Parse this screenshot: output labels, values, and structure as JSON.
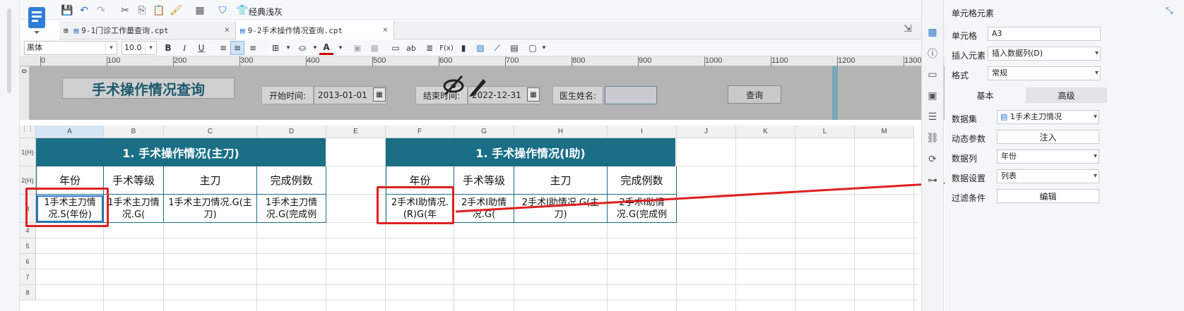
{
  "toolbar": {
    "classic_label": "经典浅灰"
  },
  "tabs": [
    {
      "label": "9-1门诊工作量查询.cpt",
      "close": "×"
    },
    {
      "label": "9-2手术操作情况查询.cpt",
      "close": "×"
    }
  ],
  "format": {
    "font_family": "黑体",
    "font_size": "10.0",
    "bold": "B",
    "italic": "I",
    "underline": "U",
    "text_color": "A",
    "ab": "ab",
    "fx": "F(x)"
  },
  "ruler": {
    "ticks": [
      "0",
      "100",
      "200",
      "300",
      "400",
      "500",
      "600",
      "700",
      "800",
      "900",
      "1000",
      "1100",
      "1200",
      "1300"
    ],
    "vruler_label": "0"
  },
  "parameters": {
    "title": "手术操作情况查询",
    "start_label": "开始时间:",
    "start_value": "2013-01-01",
    "end_label": "结束时间:",
    "end_value": "2022-12-31",
    "doctor_label": "医生姓名:",
    "doctor_value": "",
    "query_button": "查询"
  },
  "grid": {
    "columns": [
      "A",
      "B",
      "C",
      "D",
      "E",
      "F",
      "G",
      "H",
      "I",
      "J",
      "K",
      "L",
      "M"
    ],
    "rows": [
      "1(H)",
      "2(H)",
      "3",
      "4",
      "5",
      "6",
      "7",
      "8"
    ],
    "title_main": "1. 手术操作情况(主刀)",
    "title_assist": "1. 手术操作情况(I助)",
    "headers_main": [
      "年份",
      "手术等级",
      "主刀",
      "完成例数"
    ],
    "headers_assist": [
      "年份",
      "手术等级",
      "主刀",
      "完成例数"
    ],
    "data_main": [
      "1手术主刀情况.S(年份)",
      "1手术主刀情况.G(",
      "1手术主刀情况.G(主刀)",
      "1手术主刀情况.G(完成例"
    ],
    "data_assist": [
      "2手术I助情况.(R)G(年",
      "2手术I助情况.G(",
      "2手术I助情况.G(主刀)",
      "2手术I助情况.G(完成例"
    ]
  },
  "panel": {
    "title": "单元格元素",
    "cell_label": "单元格",
    "cell_value": "A3",
    "insert_label": "插入元素",
    "insert_value": "插入数据列(D)",
    "format_label": "格式",
    "format_value": "常规",
    "tab_basic": "基本",
    "tab_advanced": "高级",
    "dataset_label": "数据集",
    "dataset_value": "1手术主刀情况",
    "dynamic_label": "动态参数",
    "inject_button": "注入",
    "datacol_label": "数据列",
    "datacol_value": "年份",
    "dataset_setting_label": "数据设置",
    "dataset_setting_value": "列表",
    "filter_label": "过滤条件",
    "edit_button": "编辑"
  },
  "colors": {
    "header_teal": "#1a6f86",
    "annotation_red": "#e02020",
    "param_bg": "#b4b4b4"
  }
}
